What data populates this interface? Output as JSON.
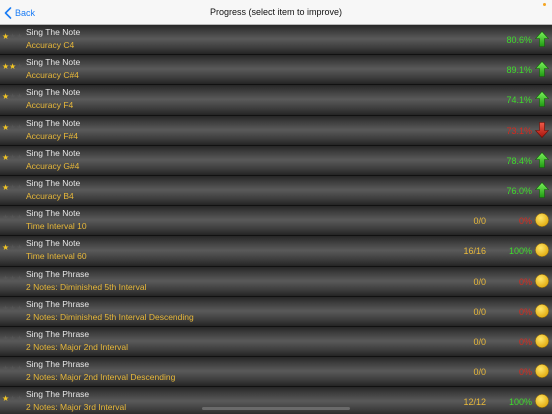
{
  "navbar": {
    "back_label": "Back",
    "title": "Progress (select item to improve)"
  },
  "rows": [
    {
      "title": "Sing The Note",
      "subtitle": "Accuracy C4",
      "stars": 1,
      "ratio": "",
      "percent": "80.6%",
      "percent_color": "green",
      "indicator": "up-arrow-icon"
    },
    {
      "title": "Sing The Note",
      "subtitle": "Accuracy C#4",
      "stars": 2,
      "ratio": "",
      "percent": "89.1%",
      "percent_color": "green",
      "indicator": "up-arrow-icon"
    },
    {
      "title": "Sing The Note",
      "subtitle": "Accuracy F4",
      "stars": 1,
      "ratio": "",
      "percent": "74.1%",
      "percent_color": "green",
      "indicator": "up-arrow-icon"
    },
    {
      "title": "Sing The Note",
      "subtitle": "Accuracy F#4",
      "stars": 1,
      "ratio": "",
      "percent": "73.1%",
      "percent_color": "red",
      "indicator": "down-arrow-icon"
    },
    {
      "title": "Sing The Note",
      "subtitle": "Accuracy G#4",
      "stars": 1,
      "ratio": "",
      "percent": "78.4%",
      "percent_color": "green",
      "indicator": "up-arrow-icon"
    },
    {
      "title": "Sing The Note",
      "subtitle": "Accuracy B4",
      "stars": 1,
      "ratio": "",
      "percent": "76.0%",
      "percent_color": "green",
      "indicator": "up-arrow-icon"
    },
    {
      "title": "Sing The Note",
      "subtitle": "Time Interval 10",
      "stars": 0,
      "ratio": "0/0",
      "percent": "0%",
      "percent_color": "red",
      "indicator": "yellow-circle-icon"
    },
    {
      "title": "Sing The Note",
      "subtitle": "Time Interval 60",
      "stars": 1,
      "ratio": "16/16",
      "percent": "100%",
      "percent_color": "green",
      "indicator": "yellow-circle-icon"
    },
    {
      "title": "Sing The Phrase",
      "subtitle": "2 Notes: Diminished 5th Interval",
      "stars": 0,
      "ratio": "0/0",
      "percent": "0%",
      "percent_color": "red",
      "indicator": "yellow-circle-icon"
    },
    {
      "title": "Sing The Phrase",
      "subtitle": "2 Notes: Diminished 5th Interval Descending",
      "stars": 0,
      "ratio": "0/0",
      "percent": "0%",
      "percent_color": "red",
      "indicator": "yellow-circle-icon"
    },
    {
      "title": "Sing The Phrase",
      "subtitle": "2 Notes: Major 2nd Interval",
      "stars": 0,
      "ratio": "0/0",
      "percent": "0%",
      "percent_color": "red",
      "indicator": "yellow-circle-icon"
    },
    {
      "title": "Sing The Phrase",
      "subtitle": "2 Notes: Major 2nd Interval Descending",
      "stars": 0,
      "ratio": "0/0",
      "percent": "0%",
      "percent_color": "red",
      "indicator": "yellow-circle-icon"
    },
    {
      "title": "Sing The Phrase",
      "subtitle": "2 Notes: Major 3rd Interval",
      "stars": 1,
      "ratio": "12/12",
      "percent": "100%",
      "percent_color": "green",
      "indicator": "yellow-circle-icon"
    }
  ],
  "colors": {
    "accent_blue": "#1a7cf5",
    "subtitle_gold": "#e9b93a",
    "good_green": "#3ddc2a",
    "bad_red": "#d8281d",
    "star_gold": "#f3c623"
  }
}
